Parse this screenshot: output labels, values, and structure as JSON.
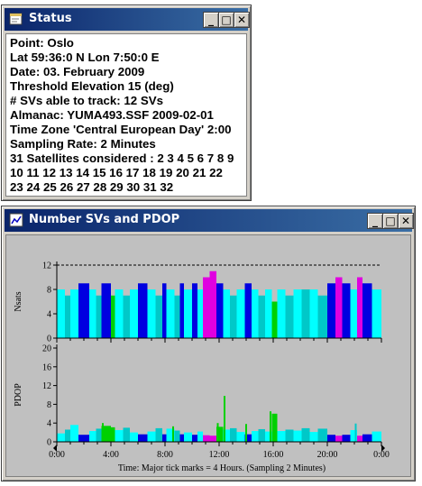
{
  "status_window": {
    "title": "Status",
    "lines": [
      "Point: Oslo",
      "Lat 59:36:0 N   Lon 7:50:0 E",
      "Date: 03. February 2009",
      "Threshold Elevation 15 (deg)",
      "# SVs able to track: 12 SVs",
      "Almanac: YUMA493.SSF  2009-02-01",
      "Time Zone 'Central European Day'  2:00",
      "Sampling Rate: 2 Minutes",
      "31 Satellites considered : 2 3 4 5 6 7 8 9",
      "10 11 12 13 14 15 16 17 18 19 20 21 22",
      "23 24 25 26 27 28 29 30 31 32"
    ]
  },
  "plot_window": {
    "title": "Number SVs and PDOP",
    "footer": "Time: Major tick marks = 4 Hours. (Sampling 2 Minutes)"
  },
  "window_buttons": {
    "minimize": "_",
    "maximize": "□",
    "close": "✕"
  },
  "icons": {
    "window_icon": "chart-window-icon"
  },
  "colors": {
    "titlebar_start": "#0a246a",
    "titlebar_end": "#3a6ea5",
    "plot_bg": "#c0c0c0",
    "cyan": "#00ffff",
    "teal": "#00c8c8",
    "blue": "#0000e0",
    "green": "#00d000",
    "magenta": "#e000e0"
  },
  "chart_data": [
    {
      "type": "bar",
      "ylabel": "Nsats",
      "ylim": [
        0,
        12
      ],
      "yticks": [
        "0",
        "4",
        "8",
        "12"
      ],
      "reference_line": 12,
      "x_range_hours": [
        0,
        24
      ],
      "segments": [
        {
          "start": 0.0,
          "end": 0.6,
          "value": 8,
          "color": "cyan"
        },
        {
          "start": 0.6,
          "end": 1.0,
          "value": 7,
          "color": "teal"
        },
        {
          "start": 1.0,
          "end": 1.6,
          "value": 8,
          "color": "cyan"
        },
        {
          "start": 1.6,
          "end": 2.4,
          "value": 9,
          "color": "blue"
        },
        {
          "start": 2.4,
          "end": 2.9,
          "value": 8,
          "color": "cyan"
        },
        {
          "start": 2.9,
          "end": 3.3,
          "value": 7,
          "color": "teal"
        },
        {
          "start": 3.3,
          "end": 4.0,
          "value": 9,
          "color": "blue"
        },
        {
          "start": 4.0,
          "end": 4.3,
          "value": 7,
          "color": "green"
        },
        {
          "start": 4.3,
          "end": 4.9,
          "value": 8,
          "color": "cyan"
        },
        {
          "start": 4.9,
          "end": 5.4,
          "value": 7,
          "color": "teal"
        },
        {
          "start": 5.4,
          "end": 6.0,
          "value": 8,
          "color": "cyan"
        },
        {
          "start": 6.0,
          "end": 6.7,
          "value": 9,
          "color": "blue"
        },
        {
          "start": 6.7,
          "end": 7.3,
          "value": 8,
          "color": "cyan"
        },
        {
          "start": 7.3,
          "end": 7.8,
          "value": 7,
          "color": "teal"
        },
        {
          "start": 7.8,
          "end": 8.1,
          "value": 9,
          "color": "blue"
        },
        {
          "start": 8.1,
          "end": 8.7,
          "value": 8,
          "color": "cyan"
        },
        {
          "start": 8.7,
          "end": 9.1,
          "value": 7,
          "color": "teal"
        },
        {
          "start": 9.1,
          "end": 9.4,
          "value": 9,
          "color": "blue"
        },
        {
          "start": 9.4,
          "end": 10.0,
          "value": 8,
          "color": "cyan"
        },
        {
          "start": 10.0,
          "end": 10.4,
          "value": 9,
          "color": "blue"
        },
        {
          "start": 10.4,
          "end": 10.8,
          "value": 8,
          "color": "cyan"
        },
        {
          "start": 10.8,
          "end": 11.3,
          "value": 10,
          "color": "magenta"
        },
        {
          "start": 11.3,
          "end": 11.8,
          "value": 11,
          "color": "magenta"
        },
        {
          "start": 11.8,
          "end": 12.3,
          "value": 9,
          "color": "blue"
        },
        {
          "start": 12.3,
          "end": 12.8,
          "value": 8,
          "color": "cyan"
        },
        {
          "start": 12.8,
          "end": 13.3,
          "value": 7,
          "color": "teal"
        },
        {
          "start": 13.3,
          "end": 13.9,
          "value": 8,
          "color": "cyan"
        },
        {
          "start": 13.9,
          "end": 14.4,
          "value": 9,
          "color": "blue"
        },
        {
          "start": 14.4,
          "end": 14.9,
          "value": 8,
          "color": "cyan"
        },
        {
          "start": 14.9,
          "end": 15.4,
          "value": 7,
          "color": "teal"
        },
        {
          "start": 15.4,
          "end": 15.9,
          "value": 8,
          "color": "cyan"
        },
        {
          "start": 15.9,
          "end": 16.3,
          "value": 6,
          "color": "green"
        },
        {
          "start": 16.3,
          "end": 16.9,
          "value": 8,
          "color": "cyan"
        },
        {
          "start": 16.9,
          "end": 17.5,
          "value": 7,
          "color": "teal"
        },
        {
          "start": 17.5,
          "end": 18.1,
          "value": 8,
          "color": "cyan"
        },
        {
          "start": 18.1,
          "end": 18.7,
          "value": 8,
          "color": "teal"
        },
        {
          "start": 18.7,
          "end": 19.3,
          "value": 8,
          "color": "cyan"
        },
        {
          "start": 19.3,
          "end": 20.0,
          "value": 7,
          "color": "teal"
        },
        {
          "start": 20.0,
          "end": 20.6,
          "value": 9,
          "color": "blue"
        },
        {
          "start": 20.6,
          "end": 21.1,
          "value": 10,
          "color": "magenta"
        },
        {
          "start": 21.1,
          "end": 21.7,
          "value": 9,
          "color": "blue"
        },
        {
          "start": 21.7,
          "end": 22.2,
          "value": 8,
          "color": "cyan"
        },
        {
          "start": 22.2,
          "end": 22.6,
          "value": 10,
          "color": "magenta"
        },
        {
          "start": 22.6,
          "end": 23.3,
          "value": 9,
          "color": "blue"
        },
        {
          "start": 23.3,
          "end": 24.0,
          "value": 8,
          "color": "cyan"
        }
      ]
    },
    {
      "type": "bar",
      "ylabel": "PDOP",
      "ylim": [
        0,
        20
      ],
      "yticks": [
        "0",
        "4",
        "8",
        "12",
        "16",
        "20"
      ],
      "xticks": [
        "0:00",
        "4:00",
        "8:00",
        "12:00",
        "16:00",
        "20:00",
        "0:00"
      ],
      "xlabel": "Time: Major tick marks = 4 Hours. (Sampling 2 Minutes)",
      "x_range_hours": [
        0,
        24
      ],
      "spikes": [
        {
          "t": 3.4,
          "value": 4.0,
          "color": "green"
        },
        {
          "t": 8.6,
          "value": 3.3,
          "color": "green"
        },
        {
          "t": 11.9,
          "value": 4.0,
          "color": "green"
        },
        {
          "t": 12.4,
          "value": 9.8,
          "color": "green"
        },
        {
          "t": 14.0,
          "value": 3.8,
          "color": "green"
        },
        {
          "t": 15.8,
          "value": 6.5,
          "color": "green"
        },
        {
          "t": 22.1,
          "value": 3.9,
          "color": "teal"
        }
      ],
      "segments": [
        {
          "start": 0.0,
          "end": 0.6,
          "value": 1.8,
          "color": "cyan"
        },
        {
          "start": 0.6,
          "end": 1.0,
          "value": 2.6,
          "color": "teal"
        },
        {
          "start": 1.0,
          "end": 1.6,
          "value": 3.6,
          "color": "cyan"
        },
        {
          "start": 1.6,
          "end": 2.4,
          "value": 1.5,
          "color": "blue"
        },
        {
          "start": 2.4,
          "end": 2.9,
          "value": 2.3,
          "color": "cyan"
        },
        {
          "start": 2.9,
          "end": 3.3,
          "value": 2.8,
          "color": "teal"
        },
        {
          "start": 3.3,
          "end": 4.0,
          "value": 3.4,
          "color": "green"
        },
        {
          "start": 4.0,
          "end": 4.3,
          "value": 3.1,
          "color": "green"
        },
        {
          "start": 4.3,
          "end": 4.9,
          "value": 2.5,
          "color": "cyan"
        },
        {
          "start": 4.9,
          "end": 5.4,
          "value": 3.0,
          "color": "teal"
        },
        {
          "start": 5.4,
          "end": 6.0,
          "value": 2.0,
          "color": "cyan"
        },
        {
          "start": 6.0,
          "end": 6.7,
          "value": 1.6,
          "color": "blue"
        },
        {
          "start": 6.7,
          "end": 7.3,
          "value": 2.2,
          "color": "cyan"
        },
        {
          "start": 7.3,
          "end": 7.8,
          "value": 2.9,
          "color": "teal"
        },
        {
          "start": 7.8,
          "end": 8.1,
          "value": 1.6,
          "color": "blue"
        },
        {
          "start": 8.1,
          "end": 8.7,
          "value": 2.8,
          "color": "cyan"
        },
        {
          "start": 8.7,
          "end": 9.1,
          "value": 2.4,
          "color": "teal"
        },
        {
          "start": 9.1,
          "end": 9.4,
          "value": 1.6,
          "color": "blue"
        },
        {
          "start": 9.4,
          "end": 10.0,
          "value": 2.0,
          "color": "cyan"
        },
        {
          "start": 10.0,
          "end": 10.4,
          "value": 1.5,
          "color": "blue"
        },
        {
          "start": 10.4,
          "end": 10.8,
          "value": 2.2,
          "color": "cyan"
        },
        {
          "start": 10.8,
          "end": 11.3,
          "value": 1.4,
          "color": "magenta"
        },
        {
          "start": 11.3,
          "end": 11.8,
          "value": 1.3,
          "color": "magenta"
        },
        {
          "start": 11.8,
          "end": 12.3,
          "value": 3.2,
          "color": "green"
        },
        {
          "start": 12.3,
          "end": 12.8,
          "value": 2.6,
          "color": "cyan"
        },
        {
          "start": 12.8,
          "end": 13.3,
          "value": 2.9,
          "color": "teal"
        },
        {
          "start": 13.3,
          "end": 13.9,
          "value": 2.1,
          "color": "cyan"
        },
        {
          "start": 13.9,
          "end": 14.4,
          "value": 1.6,
          "color": "blue"
        },
        {
          "start": 14.4,
          "end": 14.9,
          "value": 2.3,
          "color": "cyan"
        },
        {
          "start": 14.9,
          "end": 15.4,
          "value": 2.7,
          "color": "teal"
        },
        {
          "start": 15.4,
          "end": 15.9,
          "value": 2.2,
          "color": "cyan"
        },
        {
          "start": 15.9,
          "end": 16.3,
          "value": 6.0,
          "color": "green"
        },
        {
          "start": 16.3,
          "end": 16.9,
          "value": 2.3,
          "color": "cyan"
        },
        {
          "start": 16.9,
          "end": 17.5,
          "value": 2.6,
          "color": "teal"
        },
        {
          "start": 17.5,
          "end": 18.1,
          "value": 2.4,
          "color": "cyan"
        },
        {
          "start": 18.1,
          "end": 18.7,
          "value": 2.9,
          "color": "teal"
        },
        {
          "start": 18.7,
          "end": 19.3,
          "value": 2.1,
          "color": "cyan"
        },
        {
          "start": 19.3,
          "end": 20.0,
          "value": 2.8,
          "color": "teal"
        },
        {
          "start": 20.0,
          "end": 20.6,
          "value": 1.5,
          "color": "blue"
        },
        {
          "start": 20.6,
          "end": 21.1,
          "value": 1.3,
          "color": "magenta"
        },
        {
          "start": 21.1,
          "end": 21.7,
          "value": 1.5,
          "color": "blue"
        },
        {
          "start": 21.7,
          "end": 22.2,
          "value": 2.5,
          "color": "cyan"
        },
        {
          "start": 22.2,
          "end": 22.6,
          "value": 1.3,
          "color": "magenta"
        },
        {
          "start": 22.6,
          "end": 23.3,
          "value": 1.6,
          "color": "blue"
        },
        {
          "start": 23.3,
          "end": 24.0,
          "value": 2.2,
          "color": "cyan"
        }
      ]
    }
  ]
}
